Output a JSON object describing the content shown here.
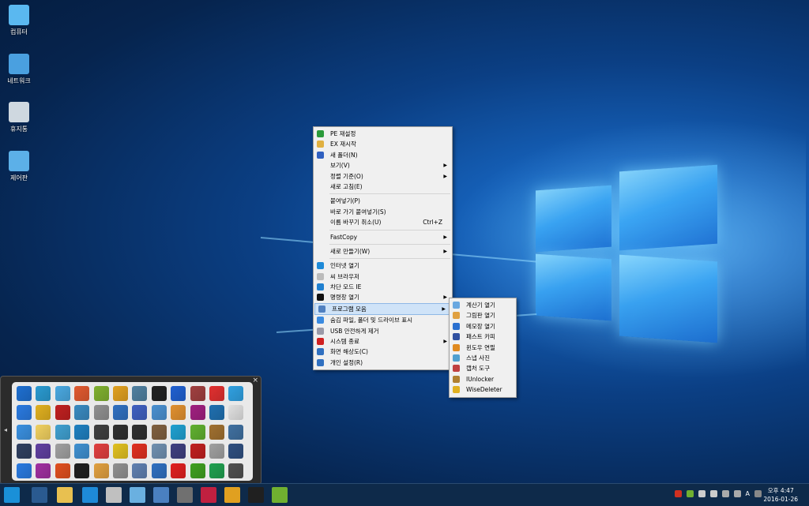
{
  "desktop_icons": [
    {
      "label": "컴퓨터",
      "icon": "computer-icon",
      "color": "#5ab8f0"
    },
    {
      "label": "네트워크",
      "icon": "network-icon",
      "color": "#4aa0e0"
    },
    {
      "label": "휴지통",
      "icon": "recycle-bin-icon",
      "color": "#cfd8e0"
    },
    {
      "label": "제어판",
      "icon": "control-panel-icon",
      "color": "#5cb0e8"
    }
  ],
  "context_menu": {
    "items": [
      {
        "label": "PE 재설정",
        "icon": "refresh-icon",
        "color": "#2a9a3a"
      },
      {
        "label": "EX 재시작",
        "icon": "explorer-icon",
        "color": "#e0b040"
      },
      {
        "label": "새 폴더(N)",
        "icon": "new-folder-icon",
        "color": "#3060c0"
      },
      {
        "label": "보기(V)",
        "submenu": true
      },
      {
        "label": "정렬 기준(O)",
        "submenu": true
      },
      {
        "label": "새로 고침(E)"
      },
      {
        "sep": true
      },
      {
        "label": "붙여넣기(P)"
      },
      {
        "label": "바로 가기 붙여넣기(S)"
      },
      {
        "label": "이름 바꾸기 취소(U)",
        "shortcut": "Ctrl+Z"
      },
      {
        "sep": true
      },
      {
        "label": "FastCopy",
        "submenu": true
      },
      {
        "sep": true
      },
      {
        "label": "새로 만들기(W)",
        "submenu": true
      },
      {
        "sep": true
      },
      {
        "label": "인터넷 열기",
        "icon": "ie-icon",
        "color": "#1e8ad8"
      },
      {
        "label": "씨 브라우저",
        "icon": "browser-icon",
        "color": "#bbbbbb"
      },
      {
        "label": "차단 모드 IE",
        "icon": "blocked-ie-icon",
        "color": "#2080d0"
      },
      {
        "label": "명령창 열기",
        "icon": "cmd-icon",
        "color": "#111111",
        "submenu": true
      },
      {
        "label": "프로그램 모음",
        "icon": "programs-icon",
        "color": "#5080c0",
        "submenu": true,
        "highlight": true
      },
      {
        "label": "숨김 파일, 폴더 및 드라이브 표시",
        "icon": "hidden-files-icon",
        "color": "#3a8ae0"
      },
      {
        "label": "USB 안전하게 제거",
        "icon": "usb-icon",
        "color": "#9a9aa8"
      },
      {
        "label": "시스템 종료",
        "icon": "power-icon",
        "color": "#d02020",
        "submenu": true
      },
      {
        "label": "화면 해상도(C)",
        "icon": "display-icon",
        "color": "#3070c0"
      },
      {
        "label": "개인 설정(R)",
        "icon": "personalize-icon",
        "color": "#3070c0"
      }
    ]
  },
  "submenu": {
    "items": [
      {
        "label": "계산기 열기",
        "icon": "calculator-icon",
        "color": "#6aa8e0"
      },
      {
        "label": "그림판 열기",
        "icon": "paint-icon",
        "color": "#e0a040"
      },
      {
        "label": "메모장 열기",
        "icon": "notepad-icon",
        "color": "#2a70d0"
      },
      {
        "label": "패스트 카피",
        "icon": "fastcopy-icon",
        "color": "#3050a0"
      },
      {
        "label": "윈도우 연필",
        "icon": "pencil-icon",
        "color": "#e08a20"
      },
      {
        "label": "스냅 사진",
        "icon": "snapshot-icon",
        "color": "#50a0d0"
      },
      {
        "label": "캡처 도구",
        "icon": "capture-icon",
        "color": "#c04040"
      },
      {
        "label": "IUnlocker",
        "icon": "unlocker-icon",
        "color": "#b08030"
      },
      {
        "label": "WiseDeleter",
        "icon": "wisedeleter-icon",
        "color": "#e0b020"
      }
    ]
  },
  "launcher": {
    "close_label": "×",
    "collapse_label": "◂",
    "colors": [
      "#1e6fd0",
      "#2a9ad0",
      "#4aa8e0",
      "#e05a30",
      "#80b030",
      "#e0a020",
      "#5080a0",
      "#222222",
      "#2060d0",
      "#a04040",
      "#e03030",
      "#30a0e0",
      "#2a7ae0",
      "#e0b020",
      "#c02020",
      "#3a8ac0",
      "#909090",
      "#3070c0",
      "#4060c0",
      "#4a90d0",
      "#e09030",
      "#a02080",
      "#2070b0",
      "#e0e0e0",
      "#3a90e0",
      "#f0d060",
      "#40a0d0",
      "#2080c0",
      "#404040",
      "#303030",
      "#303030",
      "#806040",
      "#20a0d0",
      "#60b030",
      "#a07030",
      "#4070a0",
      "#304060",
      "#6040a0",
      "#a0a0a0",
      "#4090d0",
      "#e04040",
      "#e0c020",
      "#e03020",
      "#7090b0",
      "#404080",
      "#c02020",
      "#a0a0a0",
      "#305080",
      "#2a7ae0",
      "#a030a0",
      "#e05020",
      "#202020",
      "#e0a040",
      "#909090",
      "#6080b0",
      "#3070c0",
      "#e02020",
      "#40a020",
      "#20a050",
      "#505050"
    ]
  },
  "taskbar": {
    "items": [
      {
        "icon": "start-icon",
        "color": "#1a90d8"
      },
      {
        "icon": "window-icon",
        "color": "#2a5a90"
      },
      {
        "icon": "file-explorer-icon",
        "color": "#e8c050"
      },
      {
        "icon": "ie-icon",
        "color": "#1e8ad8"
      },
      {
        "icon": "magnifier-icon",
        "color": "#c0c0c0"
      },
      {
        "icon": "search-icon",
        "color": "#6ab0e0"
      },
      {
        "icon": "display-icon",
        "color": "#4a80c0"
      },
      {
        "icon": "tool-icon",
        "color": "#707070"
      },
      {
        "icon": "network-icon",
        "color": "#c02040"
      },
      {
        "icon": "color-icon",
        "color": "#e0a020"
      },
      {
        "icon": "monitor-icon",
        "color": "#202020"
      },
      {
        "icon": "leaf-icon",
        "color": "#70b030"
      }
    ],
    "tray_text": "A",
    "clock_time": "오후 4:47",
    "clock_date": "2016-01-26"
  }
}
